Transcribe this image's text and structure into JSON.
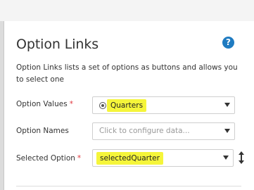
{
  "panel": {
    "title": "Option Links",
    "help_icon_glyph": "?",
    "description": "Option Links lists a set of options as buttons and allows you to select one"
  },
  "fields": {
    "option_values": {
      "label": "Option Values",
      "required_mark": "*",
      "value": "Quarters"
    },
    "option_names": {
      "label": "Option Names",
      "placeholder": "Click to configure data..."
    },
    "selected_option": {
      "label": "Selected Option",
      "required_mark": "*",
      "value": "selectedQuarter"
    }
  },
  "colors": {
    "accent": "#1f7bc1",
    "highlight": "#f5f53a",
    "required": "#e0353c"
  },
  "icons": {
    "help": "question-circle-icon",
    "radio": "radio-icon",
    "caret": "chevron-down-icon",
    "sort": "sort-vertical-icon"
  }
}
